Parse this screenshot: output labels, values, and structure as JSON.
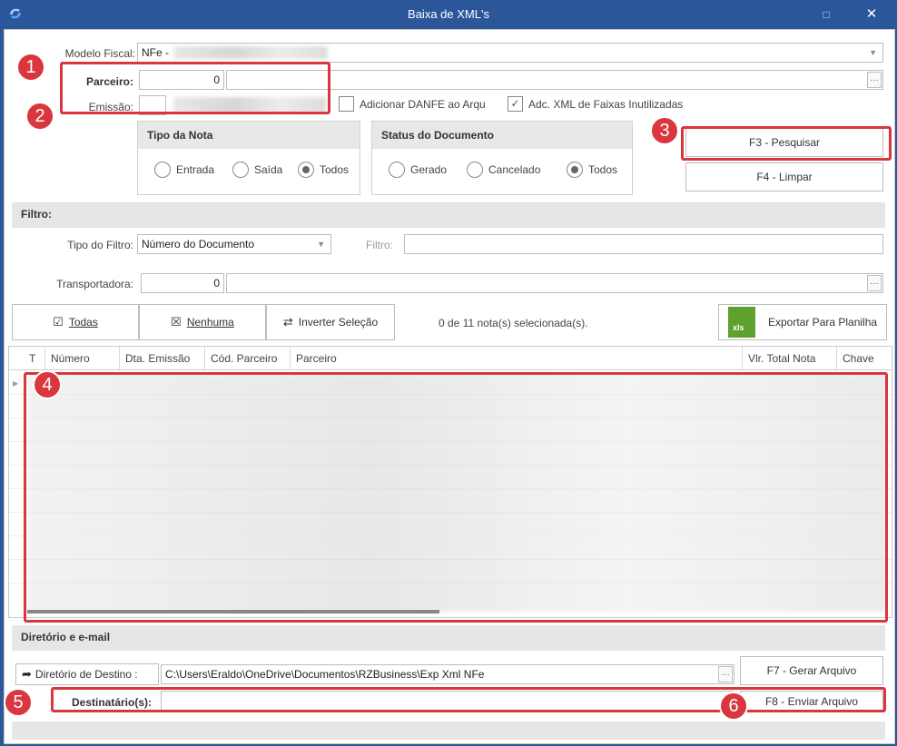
{
  "window": {
    "title": "Baixa de XML's",
    "minimize": "□",
    "close": "✕"
  },
  "top": {
    "modelo_label": "Modelo Fiscal:",
    "modelo_value": "NFe -",
    "parceiro_label": "Parceiro:",
    "parceiro_code": "0",
    "emissao_label": "Emissão:",
    "adicionar_danfe": "Adicionar DANFE ao Arqu",
    "adc_xml": "Adc. XML de Faixas Inutilizadas"
  },
  "tipo_nota": {
    "title": "Tipo da Nota",
    "options": [
      "Entrada",
      "Saída",
      "Todos"
    ],
    "selected": "Todos"
  },
  "status_documento": {
    "title": "Status do Documento",
    "options": [
      "Gerado",
      "Cancelado",
      "Todos"
    ],
    "selected": "Todos"
  },
  "buttons": {
    "pesquisar": "F3 - Pesquisar",
    "limpar": "F4 - Limpar",
    "todas": "Todas",
    "nenhuma": "Nenhuma",
    "inverter": "Inverter Seleção",
    "exportar": "Exportar Para Planilha",
    "gerar": "F7 - Gerar Arquivo",
    "enviar": "F8 - Enviar Arquivo",
    "diretorio": "Diretório de Destino :"
  },
  "filtro": {
    "section": "Filtro:",
    "tipo_label": "Tipo do Filtro:",
    "tipo_value": "Número do Documento",
    "filtro_label": "Filtro:",
    "transportadora_label": "Transportadora:",
    "transportadora_code": "0"
  },
  "selection_status": "0 de 11 nota(s) selecionada(s).",
  "xls_label": "xls",
  "grid": {
    "columns": [
      "T",
      "Número",
      "Dta. Emissão",
      "Cód. Parceiro",
      "Parceiro",
      "Vlr. Total Nota",
      "Chave"
    ]
  },
  "diretorio": {
    "section": "Diretório e e-mail",
    "path": "C:\\Users\\Eraldo\\OneDrive\\Documentos\\RZBusiness\\Exp Xml NFe",
    "destinatario_label": "Destinatário(s):"
  },
  "annotations": [
    "1",
    "2",
    "3",
    "4",
    "5",
    "6"
  ],
  "colors": {
    "titlebar": "#2b579a",
    "annotation": "#d9363e",
    "xls": "#5ea22d"
  }
}
